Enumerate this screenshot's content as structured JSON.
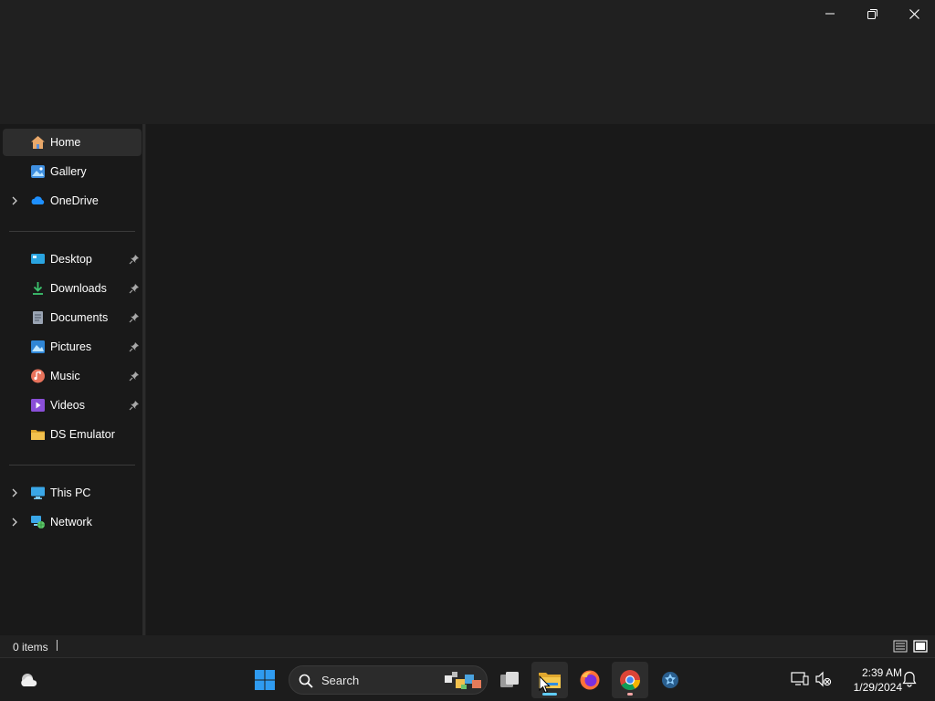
{
  "window": {
    "controls": {
      "minimize_icon": "minimize-icon",
      "restore_icon": "restore-icon",
      "close_icon": "close-icon"
    }
  },
  "nav": {
    "quick": [
      {
        "label": "Home",
        "icon": "home-icon",
        "selected": true
      },
      {
        "label": "Gallery",
        "icon": "gallery-icon"
      },
      {
        "label": "OneDrive",
        "icon": "onedrive-icon",
        "expandable": true
      }
    ],
    "pinned": [
      {
        "label": "Desktop",
        "icon": "desktop-icon",
        "pinned": true
      },
      {
        "label": "Downloads",
        "icon": "downloads-icon",
        "pinned": true
      },
      {
        "label": "Documents",
        "icon": "documents-icon",
        "pinned": true
      },
      {
        "label": "Pictures",
        "icon": "pictures-icon",
        "pinned": true
      },
      {
        "label": "Music",
        "icon": "music-icon",
        "pinned": true
      },
      {
        "label": "Videos",
        "icon": "videos-icon",
        "pinned": true
      },
      {
        "label": "DS Emulator",
        "icon": "folder-icon",
        "pinned": false
      }
    ],
    "locations": [
      {
        "label": "This PC",
        "icon": "this-pc-icon",
        "expandable": true
      },
      {
        "label": "Network",
        "icon": "network-icon",
        "expandable": true
      }
    ]
  },
  "status": {
    "item_count": "0 items"
  },
  "taskbar": {
    "search_label": "Search",
    "clock_time": "2:39 AM",
    "clock_date": "1/29/2024"
  },
  "colors": {
    "accent": "#0078d4",
    "folder": "#f2c14e",
    "active_indicator": "#60cdff",
    "chrome_indicator": "#f4a6a6"
  }
}
